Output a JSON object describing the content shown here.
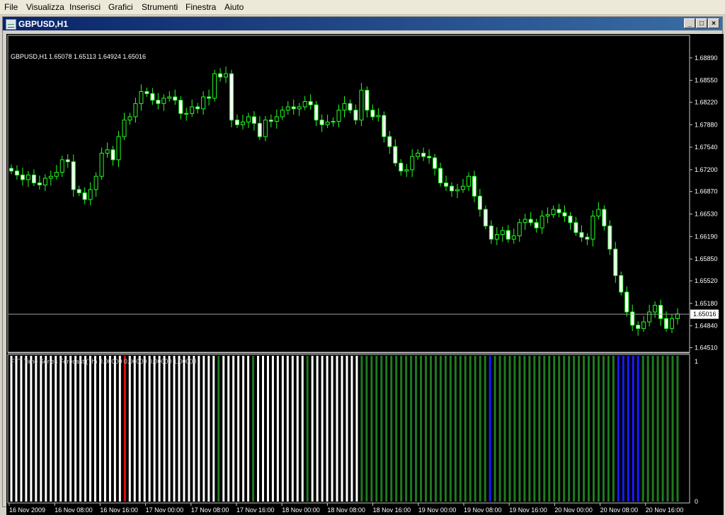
{
  "menu": [
    "File",
    "Visualizza",
    "Inserisci",
    "Grafici",
    "Strumenti",
    "Finestra",
    "Aiuto"
  ],
  "window": {
    "title": "GBPUSD,H1",
    "buttons": {
      "minimize": "_",
      "restore": "□",
      "close": "×"
    }
  },
  "chart": {
    "info_symbol": "GBPUSD,H1",
    "info_values": "1.65078 1.65113 1.64924 1.65016",
    "current_price": "1.65016",
    "current_price_value": 1.65016,
    "price_ticks": [
      "1.68890",
      "1.68550",
      "1.68220",
      "1.67880",
      "1.67540",
      "1.67200",
      "1.66870",
      "1.66530",
      "1.66190",
      "1.65850",
      "1.65520",
      "1.65180",
      "1.64840",
      "1.64510"
    ],
    "tick_values": [
      1.6889,
      1.6855,
      1.6822,
      1.6788,
      1.6754,
      1.672,
      1.6687,
      1.6653,
      1.6619,
      1.6585,
      1.6552,
      1.6518,
      1.6484,
      1.6451
    ],
    "time_labels": [
      "16 Nov 2009",
      "16 Nov 08:00",
      "16 Nov 16:00",
      "17 Nov 00:00",
      "17 Nov 08:00",
      "17 Nov 16:00",
      "18 Nov 00:00",
      "18 Nov 08:00",
      "18 Nov 16:00",
      "19 Nov 00:00",
      "19 Nov 08:00",
      "19 Nov 16:00",
      "20 Nov 00:00",
      "20 Nov 08:00",
      "20 Nov 16:00"
    ],
    "candle_closes": [
      1.6718,
      1.6712,
      1.6705,
      1.6712,
      1.67,
      1.6697,
      1.6707,
      1.671,
      1.6716,
      1.6735,
      1.6732,
      1.669,
      1.6685,
      1.6675,
      1.669,
      1.671,
      1.6745,
      1.675,
      1.6735,
      1.677,
      1.6795,
      1.68,
      1.682,
      1.6838,
      1.6835,
      1.6825,
      1.682,
      1.6828,
      1.683,
      1.6825,
      1.6805,
      1.6805,
      1.6815,
      1.6812,
      1.683,
      1.6828,
      1.6865,
      1.686,
      1.6865,
      1.6795,
      1.6788,
      1.6792,
      1.68,
      1.679,
      1.677,
      1.6795,
      1.6793,
      1.68,
      1.681,
      1.6815,
      1.6812,
      1.6815,
      1.6823,
      1.6818,
      1.6795,
      1.6788,
      1.6792,
      1.6793,
      1.681,
      1.682,
      1.681,
      1.6795,
      1.684,
      1.681,
      1.68,
      1.6802,
      1.677,
      1.6755,
      1.673,
      1.6718,
      1.672,
      1.674,
      1.6745,
      1.674,
      1.6738,
      1.6722,
      1.67,
      1.6695,
      1.6688,
      1.669,
      1.6695,
      1.671,
      1.668,
      1.666,
      1.6635,
      1.6615,
      1.6622,
      1.6628,
      1.6615,
      1.662,
      1.664,
      1.6645,
      1.664,
      1.6632,
      1.665,
      1.6652,
      1.666,
      1.6655,
      1.665,
      1.664,
      1.6625,
      1.6618,
      1.6615,
      1.665,
      1.666,
      1.6635,
      1.66,
      1.656,
      1.6535,
      1.6505,
      1.6485,
      1.648,
      1.649,
      1.6505,
      1.6515,
      1.6495,
      1.648,
      1.6495,
      1.6502
    ],
    "y_min": 1.64451,
    "y_max": 1.68952,
    "indicator": {
      "label": "FFT Time Series Forecast (7h)  0.00000 0.00000 0.00000 1.00000",
      "scale_top": "1",
      "scale_bottom": "0",
      "bar_colors": "WWWWWWWWWWWWWWWWWWWWWWWRWWWWWWWWWWWWWWWWWWGWWWWWWGWWWWWWWWWWGWWWWWWWWWWGGGGGGGGGGGGGGGGGGGGGGGGGGBGGGGGGGGGGGGGGGGGGGGGGGGGBBBBBGGGGGGGG",
      "colors": {
        "W": "#ffffff",
        "G": "#1f7a1f",
        "R": "#e01010",
        "B": "#1a1aff"
      }
    },
    "colors": {
      "background": "#000000",
      "candle_up_body": "#000000",
      "candle_down_body": "#ffffff",
      "candle_wick": "#22ff22",
      "grid_line": "#c8c8c8",
      "axis_text": "#ffffff"
    }
  }
}
